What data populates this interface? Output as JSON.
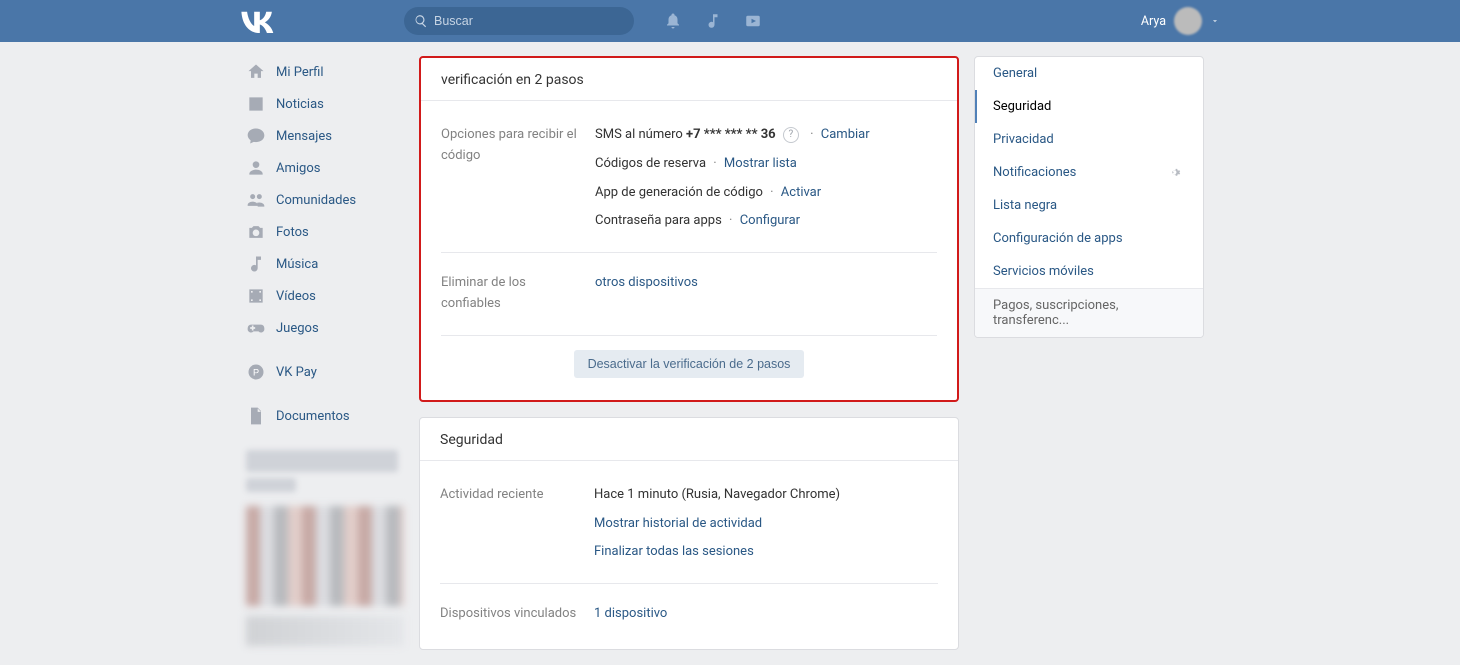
{
  "header": {
    "search_placeholder": "Buscar",
    "user_name": "Arya"
  },
  "left_nav": {
    "items": [
      {
        "id": "profile",
        "label": "Mi Perfil"
      },
      {
        "id": "news",
        "label": "Noticias"
      },
      {
        "id": "messages",
        "label": "Mensajes"
      },
      {
        "id": "friends",
        "label": "Amigos"
      },
      {
        "id": "communities",
        "label": "Comunidades"
      },
      {
        "id": "photos",
        "label": "Fotos"
      },
      {
        "id": "music",
        "label": "Música"
      },
      {
        "id": "videos",
        "label": "Vídeos"
      },
      {
        "id": "games",
        "label": "Juegos"
      },
      {
        "id": "vkpay",
        "label": "VK Pay"
      },
      {
        "id": "documents",
        "label": "Documentos"
      }
    ]
  },
  "right_nav": {
    "items": [
      {
        "id": "general",
        "label": "General"
      },
      {
        "id": "security",
        "label": "Seguridad",
        "active": true
      },
      {
        "id": "privacy",
        "label": "Privacidad"
      },
      {
        "id": "notifications",
        "label": "Notificaciones",
        "has_gear": true
      },
      {
        "id": "blacklist",
        "label": "Lista negra"
      },
      {
        "id": "apps",
        "label": "Configuración de apps"
      },
      {
        "id": "mobile",
        "label": "Servicios móviles"
      },
      {
        "id": "payments",
        "label": "Pagos, suscripciones, transferenc...",
        "muted": true
      }
    ]
  },
  "two_step": {
    "title": "verificación en 2 pasos",
    "options_label": "Opciones para recibir el código",
    "sms_prefix": "SMS al número ",
    "sms_number": "+7 *** *** ** 36",
    "change_link": "Cambiar",
    "backup_label": "Códigos de reserva",
    "show_list_link": "Mostrar lista",
    "codegen_label": "App de generación de código",
    "activate_link": "Activar",
    "app_pw_label": "Contraseña para apps",
    "configure_link": "Configurar",
    "trusted_label": "Eliminar de los confiables",
    "other_devices_link": "otros dispositivos",
    "disable_button": "Desactivar la verificación de 2 pasos"
  },
  "security": {
    "title": "Seguridad",
    "recent_label": "Actividad reciente",
    "recent_value": "Hace 1 minuto (Rusia, Navegador Chrome)",
    "history_link": "Mostrar historial de actividad",
    "end_sessions_link": "Finalizar todas las sesiones",
    "linked_label": "Dispositivos vinculados",
    "linked_value": "1 dispositivo"
  }
}
